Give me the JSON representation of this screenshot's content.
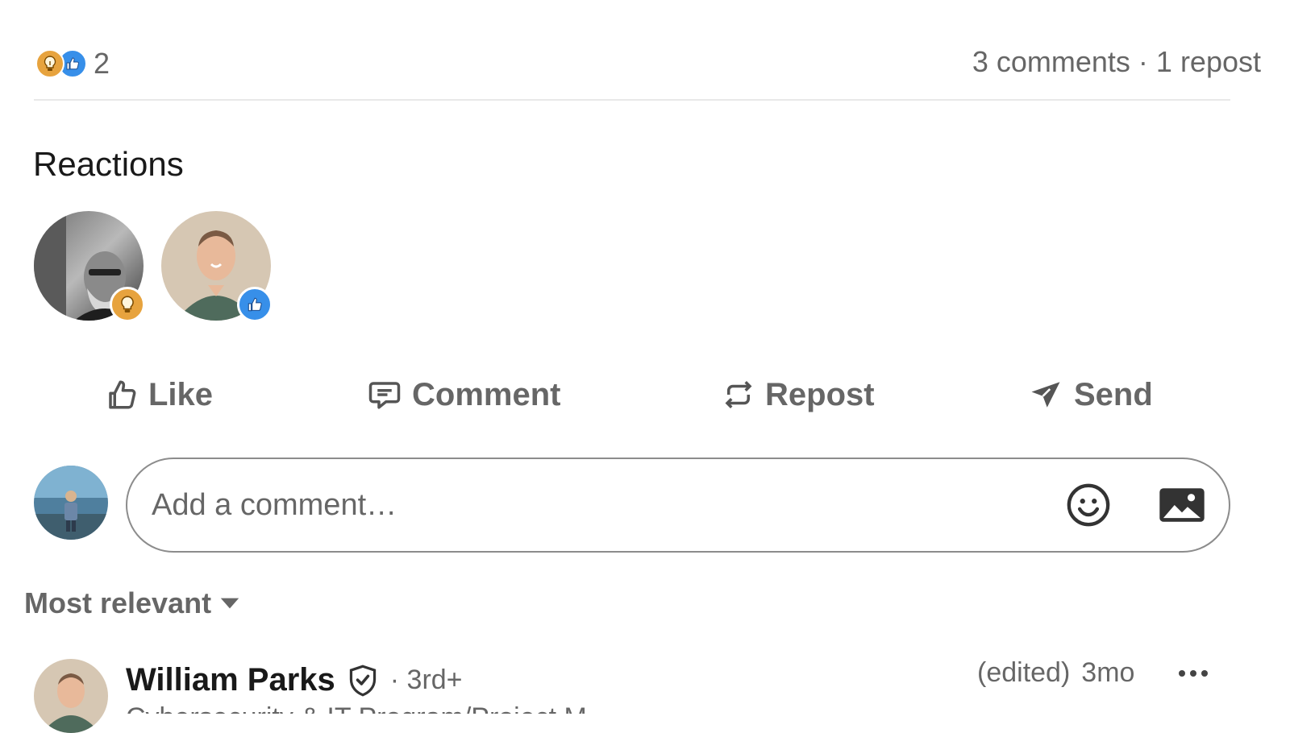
{
  "social_counts": {
    "reaction_count": "2",
    "comments": "3 comments",
    "separator": "·",
    "reposts": "1 repost"
  },
  "reactions": {
    "title": "Reactions",
    "people": [
      {
        "reaction": "insightful",
        "avatar": "grayscale-man-avatar"
      },
      {
        "reaction": "like",
        "avatar": "man-green-shirt-avatar"
      }
    ]
  },
  "actions": {
    "like": "Like",
    "comment": "Comment",
    "repost": "Repost",
    "send": "Send"
  },
  "composer": {
    "placeholder": "Add a comment…",
    "emoji_icon": "emoji-icon",
    "image_icon": "image-icon"
  },
  "sort": {
    "label": "Most relevant"
  },
  "comment": {
    "author": "William Parks",
    "degree": "· 3rd+",
    "edited": "(edited)",
    "time": "3mo",
    "headline": "Cybersecurity & IT Program/Project M"
  },
  "colors": {
    "like_blue": "#378fe9",
    "insight_gold": "#e7a33e",
    "text_secondary": "#666666",
    "border": "#8c8c8c"
  }
}
